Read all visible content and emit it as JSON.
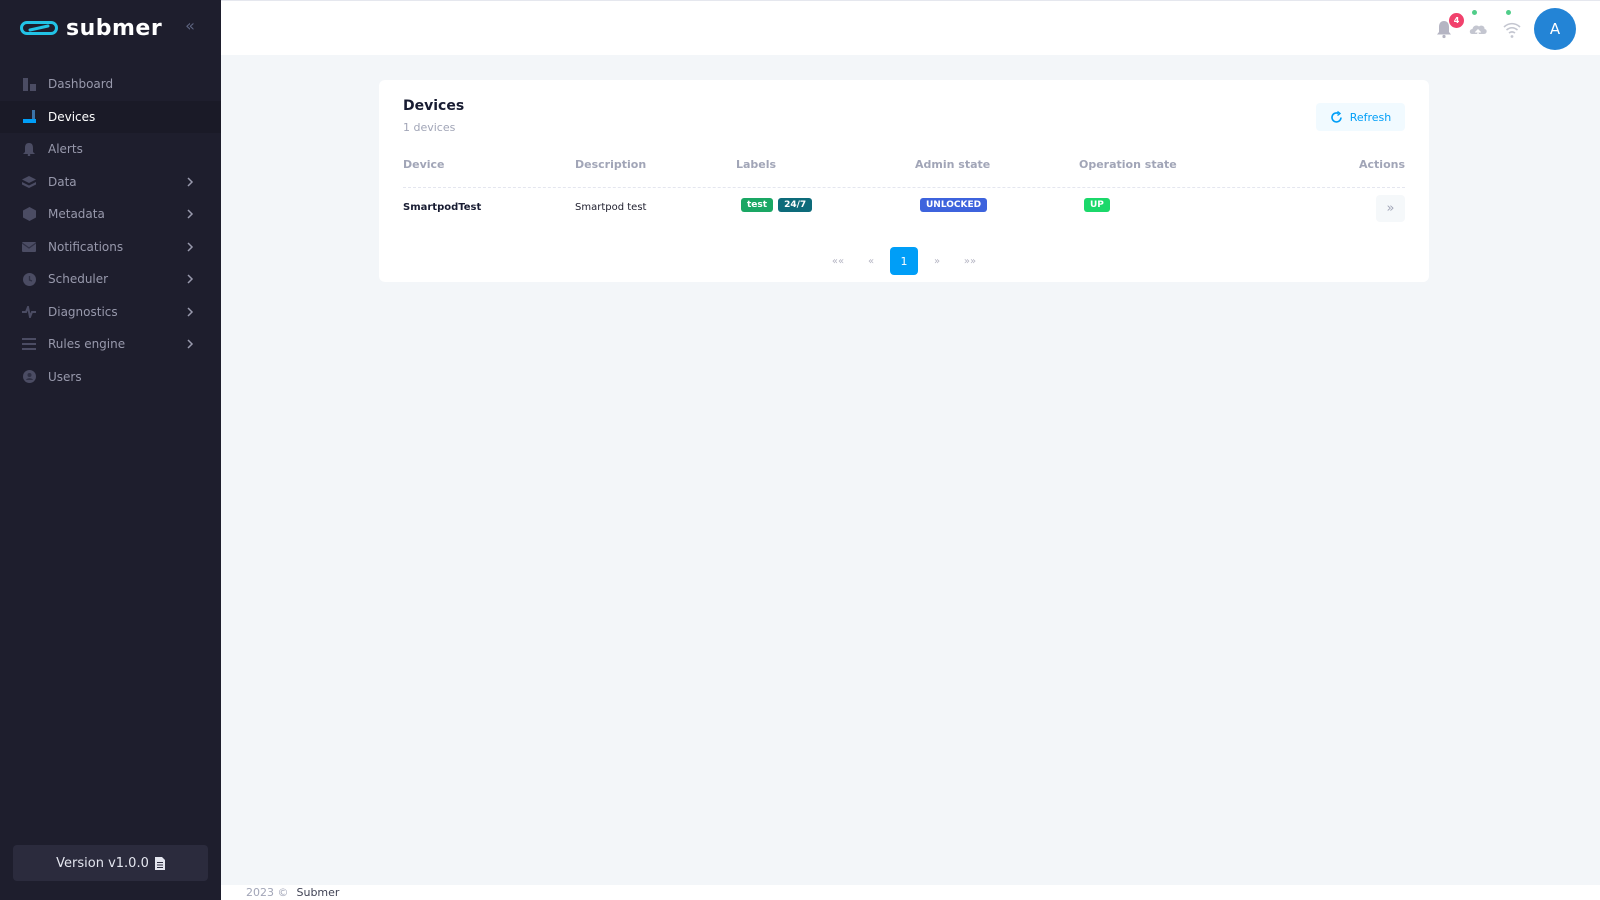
{
  "brand": {
    "name": "submer"
  },
  "sidebar": {
    "items": [
      {
        "label": "Dashboard",
        "icon": "dashboard-icon",
        "active": false,
        "expandable": false
      },
      {
        "label": "Devices",
        "icon": "devices-icon",
        "active": true,
        "expandable": false
      },
      {
        "label": "Alerts",
        "icon": "alerts-icon",
        "active": false,
        "expandable": false
      },
      {
        "label": "Data",
        "icon": "data-icon",
        "active": false,
        "expandable": true
      },
      {
        "label": "Metadata",
        "icon": "metadata-icon",
        "active": false,
        "expandable": true
      },
      {
        "label": "Notifications",
        "icon": "notifications-icon",
        "active": false,
        "expandable": true
      },
      {
        "label": "Scheduler",
        "icon": "scheduler-icon",
        "active": false,
        "expandable": true
      },
      {
        "label": "Diagnostics",
        "icon": "diagnostics-icon",
        "active": false,
        "expandable": true
      },
      {
        "label": "Rules engine",
        "icon": "rules-icon",
        "active": false,
        "expandable": true
      },
      {
        "label": "Users",
        "icon": "users-icon",
        "active": false,
        "expandable": false
      }
    ],
    "version_label": "Version v1.0.0"
  },
  "header": {
    "notification_count": "4",
    "avatar_initial": "A"
  },
  "card": {
    "title": "Devices",
    "subtitle": "1 devices",
    "refresh_label": "Refresh",
    "columns": [
      "Device",
      "Description",
      "Labels",
      "Admin state",
      "Operation state",
      "Actions"
    ],
    "rows": [
      {
        "device": "SmartpodTest",
        "description": "Smartpod test",
        "labels": [
          {
            "text": "test",
            "color": "#1aa764"
          },
          {
            "text": "24/7",
            "color": "#0d6b7a"
          }
        ],
        "admin_state": {
          "text": "UNLOCKED",
          "color": "#3d63dd"
        },
        "operation_state": {
          "text": "UP",
          "color": "#1bd86a"
        }
      }
    ],
    "pagination": {
      "first": "««",
      "prev": "«",
      "current": "1",
      "next": "»",
      "last": "»»"
    }
  },
  "footer": {
    "year": "2023 ©",
    "company": "Submer"
  },
  "colors": {
    "accent": "#009ef7",
    "sidebar_bg": "#1e1e2d",
    "badge_red": "#f1416c",
    "status_green": "#50cd89"
  }
}
